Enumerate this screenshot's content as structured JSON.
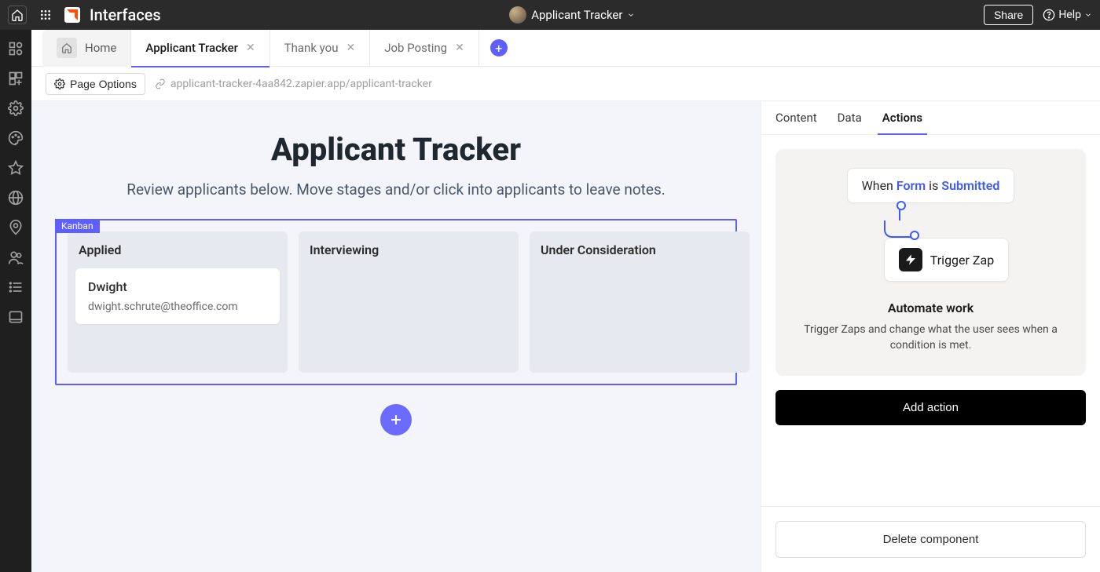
{
  "topbar": {
    "app_name": "Interfaces",
    "project_name": "Applicant Tracker",
    "share_label": "Share",
    "help_label": "Help"
  },
  "tabs": [
    {
      "label": "Home",
      "kind": "home"
    },
    {
      "label": "Applicant Tracker",
      "closable": true,
      "active": true
    },
    {
      "label": "Thank you",
      "closable": true
    },
    {
      "label": "Job Posting",
      "closable": true
    }
  ],
  "options_row": {
    "page_options_label": "Page Options",
    "url": "applicant-tracker-4aa842.zapier.app/applicant-tracker"
  },
  "canvas": {
    "title": "Applicant Tracker",
    "subtitle": "Review applicants below. Move stages and/or click into applicants to leave notes.",
    "kanban_label": "Kanban",
    "columns": [
      {
        "title": "Applied",
        "cards": [
          {
            "title": "Dwight",
            "subtitle": "dwight.schrute@theoffice.com"
          }
        ]
      },
      {
        "title": "Interviewing",
        "cards": []
      },
      {
        "title": "Under Consideration",
        "cards": []
      }
    ]
  },
  "right_panel": {
    "tabs": [
      {
        "label": "Content"
      },
      {
        "label": "Data"
      },
      {
        "label": "Actions",
        "active": true
      }
    ],
    "flow": {
      "when_word": "When",
      "form_word": "Form",
      "is_word": "is",
      "submitted_word": "Submitted",
      "trigger_label": "Trigger Zap",
      "heading": "Automate work",
      "description": "Trigger Zaps and change what the user sees when a condition is met."
    },
    "add_action_label": "Add action",
    "delete_label": "Delete component"
  }
}
